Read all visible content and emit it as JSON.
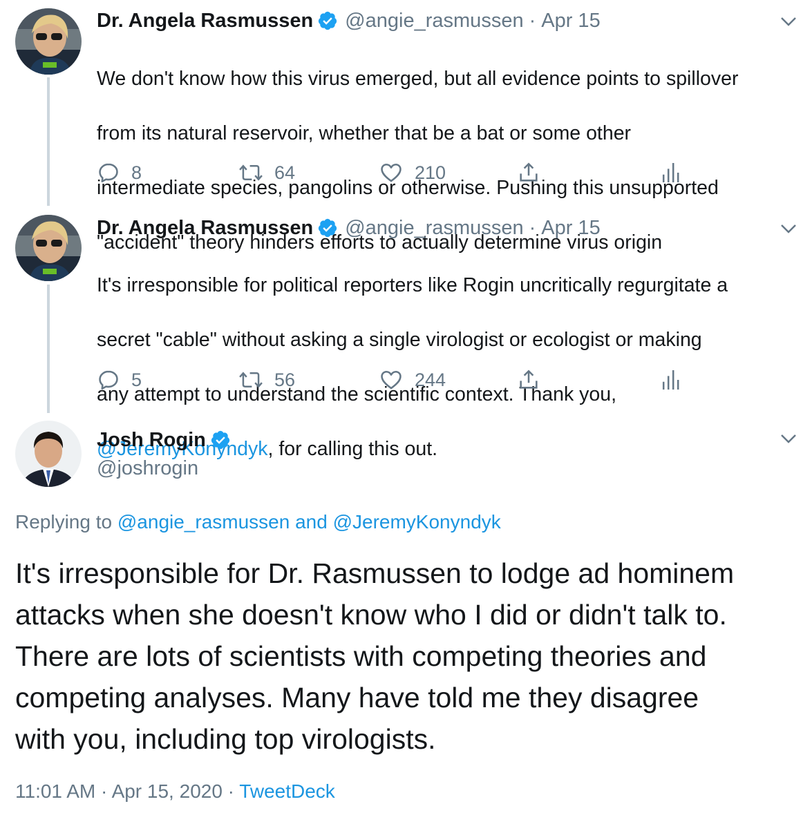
{
  "tweets": [
    {
      "name": "Dr. Angela Rasmussen",
      "handle": "@angie_rasmussen",
      "date": "Apr 15",
      "text_lines": [
        "We don't know how this virus emerged, but all evidence points to spillover",
        "from its natural reservoir, whether that be a bat or some other",
        "intermediate species, pangolins or otherwise. Pushing this unsupported",
        "\"accident\" theory hinders efforts to actually determine virus origin"
      ],
      "replies": "8",
      "retweets": "64",
      "likes": "210"
    },
    {
      "name": "Dr. Angela Rasmussen",
      "handle": "@angie_rasmussen",
      "date": "Apr 15",
      "text_lines": [
        "It's irresponsible for political reporters like Rogin uncritically regurgitate a",
        "secret \"cable\" without asking a single virologist or ecologist or making",
        "any attempt to understand the scientific context. Thank you,"
      ],
      "mention": "@JeremyKonyndyk",
      "text_after_mention": ", for calling this out.",
      "replies": "5",
      "retweets": "56",
      "likes": "244"
    }
  ],
  "main_tweet": {
    "name": "Josh Rogin",
    "handle": "@joshrogin",
    "replying_prefix": "Replying to",
    "replying_to": "@angie_rasmussen and @JeremyKonyndyk",
    "text": "It's irresponsible for Dr. Rasmussen to lodge ad hominem\nattacks when she doesn't know who I did or didn't talk to.\nThere are lots of scientists with competing theories and\ncompeting analyses. Many have told me they disagree\nwith you, including top virologists.",
    "timestamp": "11:01 AM · Apr 15, 2020 ·",
    "source": "TweetDeck"
  },
  "colors": {
    "link": "#1b95e0",
    "secondary": "#657786",
    "verified": "#1da1f2",
    "thread_line": "#ccd6dd"
  },
  "icons": [
    "verified-badge-icon",
    "chevron-down-icon",
    "reply-icon",
    "retweet-icon",
    "like-icon",
    "share-icon",
    "analytics-icon"
  ]
}
